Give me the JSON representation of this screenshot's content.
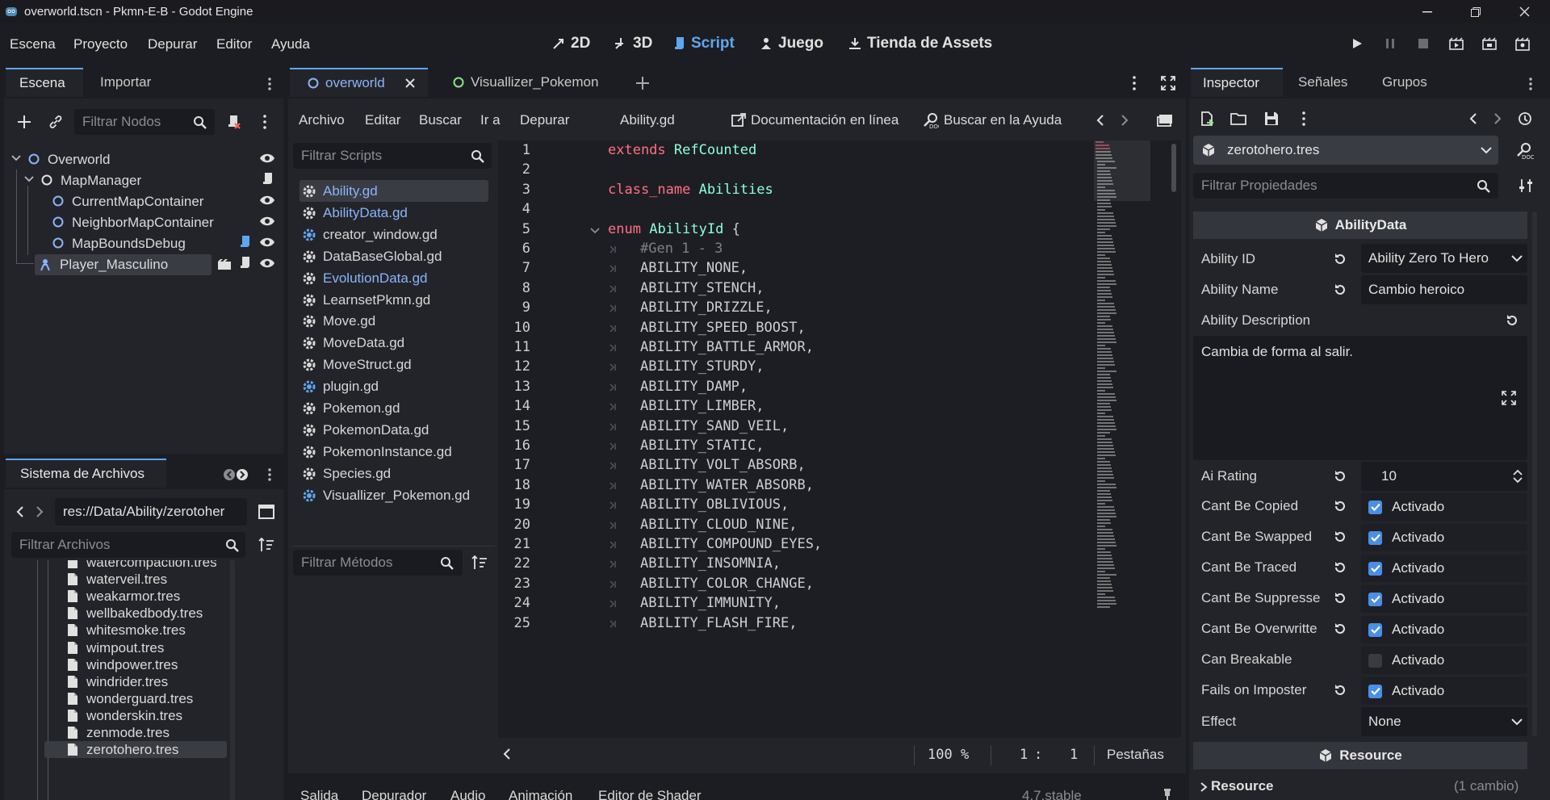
{
  "window": {
    "title": "overworld.tscn - Pkmn-E-B - Godot Engine"
  },
  "menu": [
    "Escena",
    "Proyecto",
    "Depurar",
    "Editor",
    "Ayuda"
  ],
  "workspaces": {
    "w2d": "2D",
    "w3d": "3D",
    "script": "Script",
    "game": "Juego",
    "assets": "Tienda de Assets"
  },
  "scene_dock": {
    "tabs": [
      "Escena",
      "Importar"
    ],
    "filter_placeholder": "Filtrar Nodos",
    "nodes": [
      "Overworld",
      "MapManager",
      "CurrentMapContainer",
      "NeighborMapContainer",
      "MapBoundsDebug",
      "Player_Masculino"
    ]
  },
  "filesystem": {
    "tab": "Sistema de Archivos",
    "path": "res://Data/Ability/zerotoher",
    "filter_placeholder": "Filtrar Archivos",
    "files": [
      "watercompaction.tres",
      "waterveil.tres",
      "weakarmor.tres",
      "wellbakedbody.tres",
      "whitesmoke.tres",
      "wimpout.tres",
      "windpower.tres",
      "windrider.tres",
      "wonderguard.tres",
      "wonderskin.tres",
      "zenmode.tres",
      "zerotohero.tres"
    ]
  },
  "editor": {
    "tabs": [
      "overworld",
      "Visuallizer_Pokemon"
    ],
    "menu": [
      "Archivo",
      "Editar",
      "Buscar",
      "Ir a",
      "Depurar"
    ],
    "current_file": "Ability.gd",
    "docs_online": "Documentación en línea",
    "search_help": "Buscar en la Ayuda",
    "filter_scripts": "Filtrar Scripts",
    "filter_methods": "Filtrar Métodos",
    "scripts": [
      {
        "name": "Ability.gd",
        "blue": true
      },
      {
        "name": "AbilityData.gd",
        "blue": true
      },
      {
        "name": "creator_window.gd",
        "blue": false
      },
      {
        "name": "DataBaseGlobal.gd",
        "blue": false
      },
      {
        "name": "EvolutionData.gd",
        "blue": true
      },
      {
        "name": "LearnsetPkmn.gd",
        "blue": false
      },
      {
        "name": "Move.gd",
        "blue": false
      },
      {
        "name": "MoveData.gd",
        "blue": false
      },
      {
        "name": "MoveStruct.gd",
        "blue": false
      },
      {
        "name": "plugin.gd",
        "blue": false
      },
      {
        "name": "Pokemon.gd",
        "blue": false
      },
      {
        "name": "PokemonData.gd",
        "blue": false
      },
      {
        "name": "PokemonInstance.gd",
        "blue": false
      },
      {
        "name": "Species.gd",
        "blue": false
      },
      {
        "name": "Visuallizer_Pokemon.gd",
        "blue": false
      }
    ],
    "code": [
      {
        "n": "1",
        "t": "extends RefCounted"
      },
      {
        "n": "2",
        "t": ""
      },
      {
        "n": "3",
        "t": "class_name Abilities"
      },
      {
        "n": "4",
        "t": ""
      },
      {
        "n": "5",
        "t": "enum AbilityId {"
      },
      {
        "n": "6",
        "t": "#Gen 1 - 3"
      },
      {
        "n": "7",
        "t": "ABILITY_NONE,"
      },
      {
        "n": "8",
        "t": "ABILITY_STENCH,"
      },
      {
        "n": "9",
        "t": "ABILITY_DRIZZLE,"
      },
      {
        "n": "10",
        "t": "ABILITY_SPEED_BOOST,"
      },
      {
        "n": "11",
        "t": "ABILITY_BATTLE_ARMOR,"
      },
      {
        "n": "12",
        "t": "ABILITY_STURDY,"
      },
      {
        "n": "13",
        "t": "ABILITY_DAMP,"
      },
      {
        "n": "14",
        "t": "ABILITY_LIMBER,"
      },
      {
        "n": "15",
        "t": "ABILITY_SAND_VEIL,"
      },
      {
        "n": "16",
        "t": "ABILITY_STATIC,"
      },
      {
        "n": "17",
        "t": "ABILITY_VOLT_ABSORB,"
      },
      {
        "n": "18",
        "t": "ABILITY_WATER_ABSORB,"
      },
      {
        "n": "19",
        "t": "ABILITY_OBLIVIOUS,"
      },
      {
        "n": "20",
        "t": "ABILITY_CLOUD_NINE,"
      },
      {
        "n": "21",
        "t": "ABILITY_COMPOUND_EYES,"
      },
      {
        "n": "22",
        "t": "ABILITY_INSOMNIA,"
      },
      {
        "n": "23",
        "t": "ABILITY_COLOR_CHANGE,"
      },
      {
        "n": "24",
        "t": "ABILITY_IMMUNITY,"
      },
      {
        "n": "25",
        "t": "ABILITY_FLASH_FIRE,"
      }
    ],
    "status": {
      "zoom": "100 %",
      "line": "1",
      "sep": ":",
      "col": "1",
      "indent": "Pestañas"
    }
  },
  "bottom_tabs": [
    "Salida",
    "Depurador",
    "Audio",
    "Animación",
    "Editor de Shader"
  ],
  "version": "4.7.stable",
  "inspector": {
    "tabs": [
      "Inspector",
      "Señales",
      "Grupos"
    ],
    "resource_file": "zerotohero.tres",
    "filter_placeholder": "Filtrar Propiedades",
    "section": "AbilityData",
    "ability_id_label": "Ability ID",
    "ability_id_value": "Ability Zero To Hero",
    "ability_name_label": "Ability Name",
    "ability_name_value": "Cambio heroico",
    "ability_desc_label": "Ability Description",
    "ability_desc_value": "Cambia de forma al salir.",
    "ai_rating_label": "Ai Rating",
    "ai_rating_value": "10",
    "checks": [
      {
        "label": "Cant Be Copied",
        "value": "Activado",
        "on": true,
        "revert": true
      },
      {
        "label": "Cant Be Swapped",
        "value": "Activado",
        "on": true,
        "revert": true
      },
      {
        "label": "Cant Be Traced",
        "value": "Activado",
        "on": true,
        "revert": true
      },
      {
        "label": "Cant Be Suppresse",
        "value": "Activado",
        "on": true,
        "revert": true
      },
      {
        "label": "Cant Be Overwritte",
        "value": "Activado",
        "on": true,
        "revert": true
      },
      {
        "label": "Can Breakable",
        "value": "Activado",
        "on": false,
        "revert": false
      },
      {
        "label": "Fails on Imposter",
        "value": "Activado",
        "on": true,
        "revert": true
      }
    ],
    "effect_label": "Effect",
    "effect_value": "None",
    "resource_section": "Resource",
    "resource_group": "Resource",
    "resource_changes": "(1 cambio)"
  },
  "colors": {
    "accent": "#5fa6f0",
    "keyword": "#ff7085",
    "type": "#8effda",
    "comment": "#7f8086",
    "checkbox": "#4a8fe7"
  }
}
